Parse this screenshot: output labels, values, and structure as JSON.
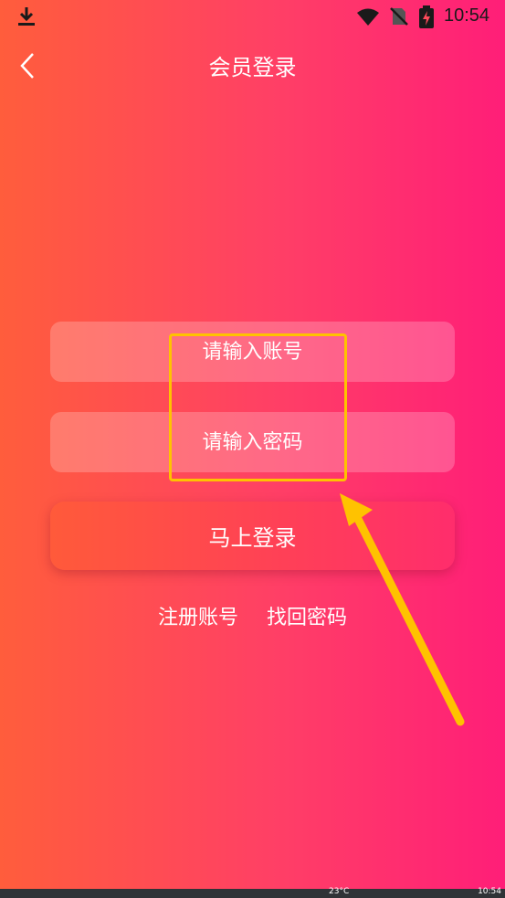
{
  "status_bar": {
    "time": "10:54"
  },
  "nav": {
    "title": "会员登录"
  },
  "form": {
    "account_placeholder": "请输入账号",
    "password_placeholder": "请输入密码",
    "login_label": "马上登录"
  },
  "links": {
    "register": "注册账号",
    "recover": "找回密码"
  },
  "annotation": {
    "highlight_color": "#ffc200"
  },
  "taskbar": {
    "temp": "23°C",
    "time": "10:54"
  }
}
